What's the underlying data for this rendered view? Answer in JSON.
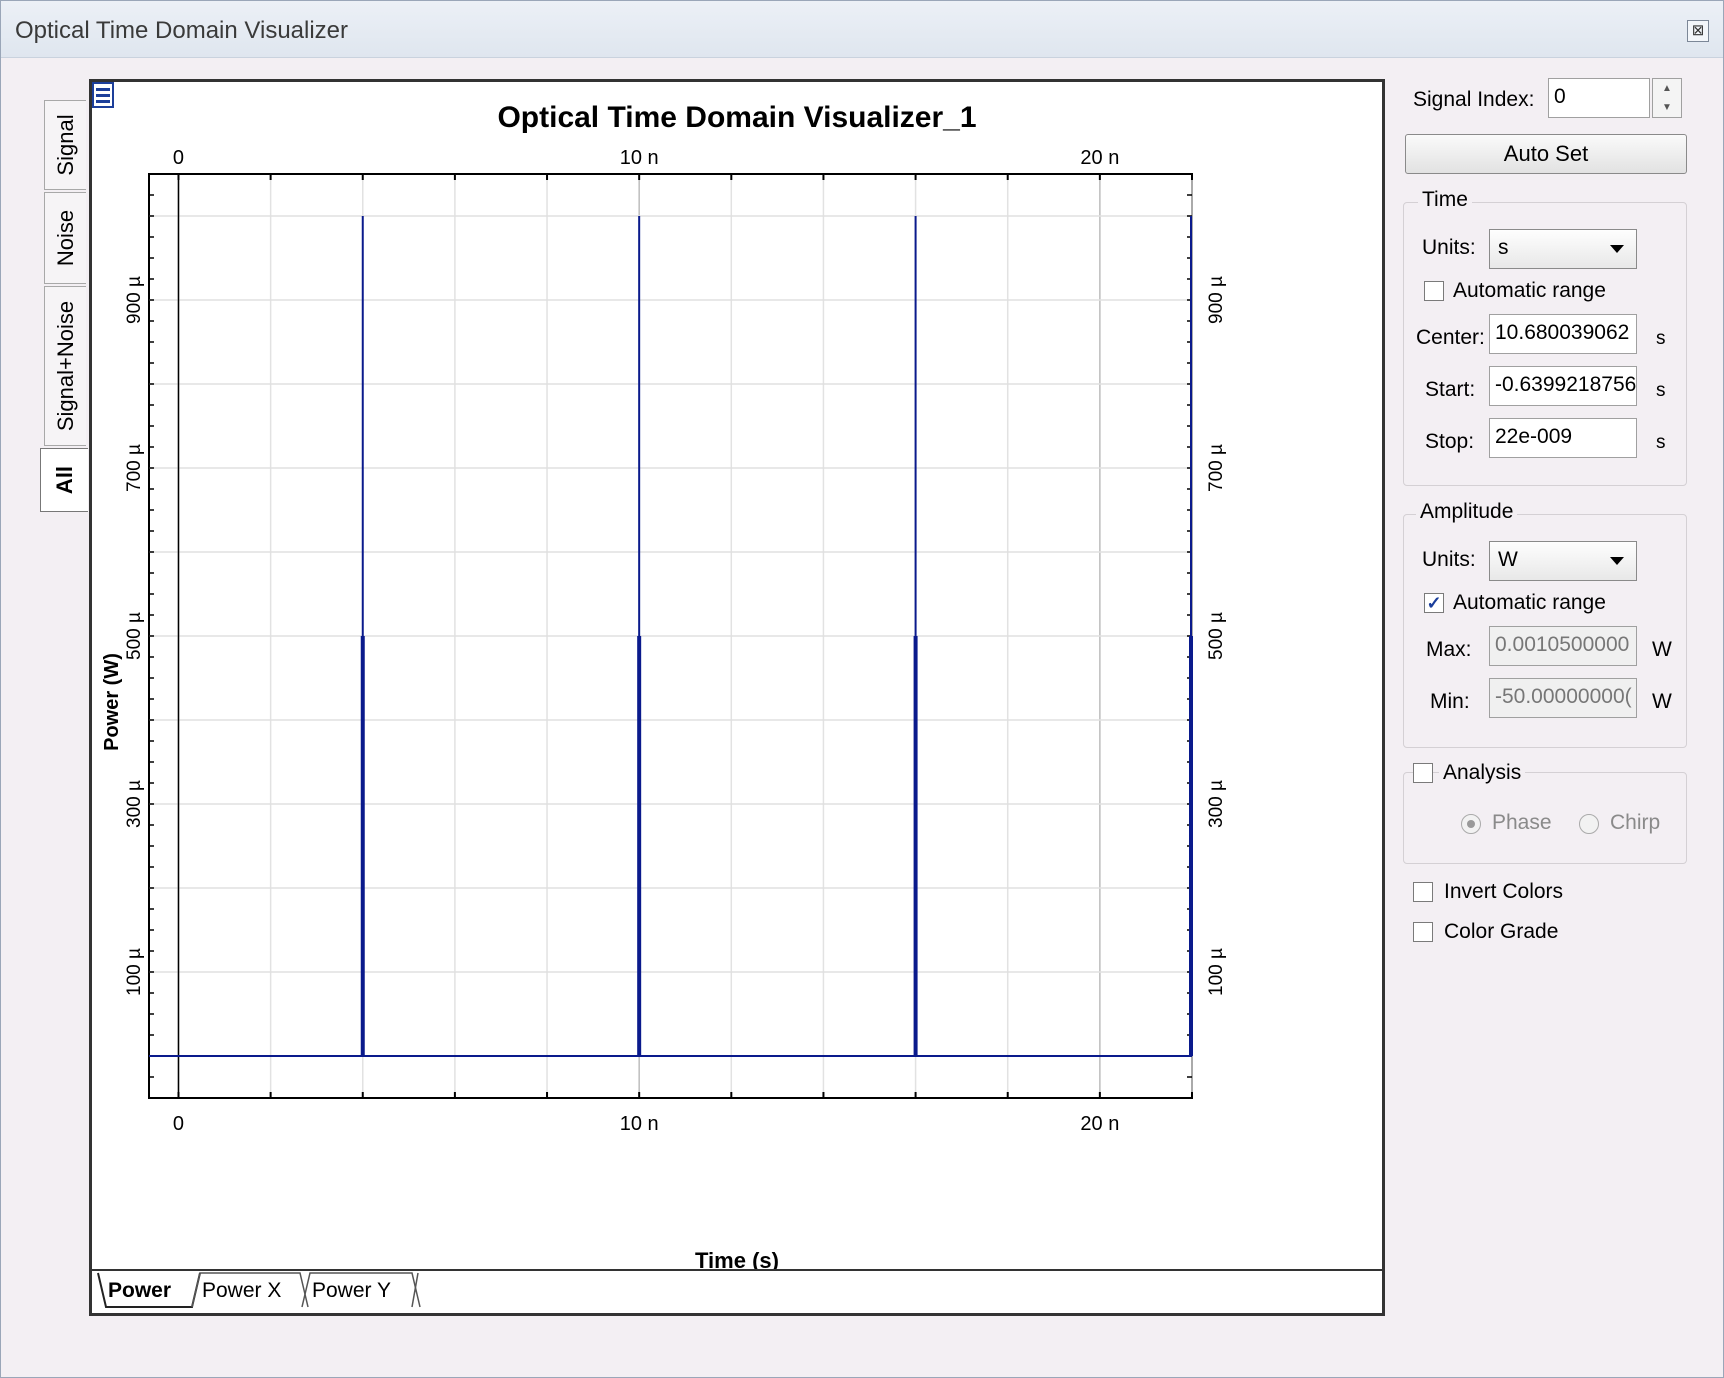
{
  "window": {
    "title": "Optical Time Domain Visualizer",
    "close_symbol": "⊠"
  },
  "side_tabs": [
    {
      "label": "Signal",
      "active": false
    },
    {
      "label": "Noise",
      "active": false
    },
    {
      "label": "Signal+Noise",
      "active": false
    },
    {
      "label": "All",
      "active": true
    }
  ],
  "bottom_tabs": [
    {
      "label": "Power",
      "active": true
    },
    {
      "label": "Power X",
      "active": false
    },
    {
      "label": "Power Y",
      "active": false
    }
  ],
  "chart_data": {
    "type": "line",
    "title": "Optical Time Domain Visualizer_1",
    "xlabel": "Time (s)",
    "ylabel": "Power (W)",
    "xlim": [
      -6.4e-10,
      2.2e-08
    ],
    "ylim": [
      -5e-05,
      0.00105
    ],
    "x_ticks": [
      {
        "value": 0,
        "label": "0"
      },
      {
        "value": 1e-08,
        "label": "10 n"
      },
      {
        "value": 2e-08,
        "label": "20 n"
      }
    ],
    "y_ticks": [
      {
        "value": 0.0001,
        "label": "100 µ"
      },
      {
        "value": 0.0003,
        "label": "300 µ"
      },
      {
        "value": 0.0005,
        "label": "500 µ"
      },
      {
        "value": 0.0007,
        "label": "700 µ"
      },
      {
        "value": 0.0009,
        "label": "900 µ"
      }
    ],
    "grid": true,
    "series": [
      {
        "color": "#0a1a8c",
        "impulses": [
          {
            "x": 4e-09,
            "y": 0.001
          },
          {
            "x": 1e-08,
            "y": 0.001
          },
          {
            "x": 1.6e-08,
            "y": 0.001
          },
          {
            "x": 2.2e-08,
            "y": 0.001
          }
        ],
        "baseline": 0
      }
    ]
  },
  "panel": {
    "signal_index_label": "Signal Index:",
    "signal_index_value": "0",
    "auto_set_label": "Auto Set",
    "time": {
      "title": "Time",
      "units_label": "Units:",
      "units_value": "s",
      "auto_range_label": "Automatic range",
      "auto_range_checked": false,
      "center_label": "Center:",
      "center_value": "10.680039062",
      "center_unit": "s",
      "start_label": "Start:",
      "start_value": "-0.6399218756",
      "start_unit": "s",
      "stop_label": "Stop:",
      "stop_value": "22e-009",
      "stop_unit": "s"
    },
    "amplitude": {
      "title": "Amplitude",
      "units_label": "Units:",
      "units_value": "W",
      "auto_range_label": "Automatic range",
      "auto_range_checked": true,
      "max_label": "Max:",
      "max_value": "0.0010500000",
      "max_unit": "W",
      "min_label": "Min:",
      "min_value": "-50.00000000(",
      "min_unit": "W"
    },
    "analysis": {
      "title": "Analysis",
      "checked": false,
      "phase_label": "Phase",
      "chirp_label": "Chirp"
    },
    "invert_colors_label": "Invert Colors",
    "color_grade_label": "Color Grade"
  }
}
